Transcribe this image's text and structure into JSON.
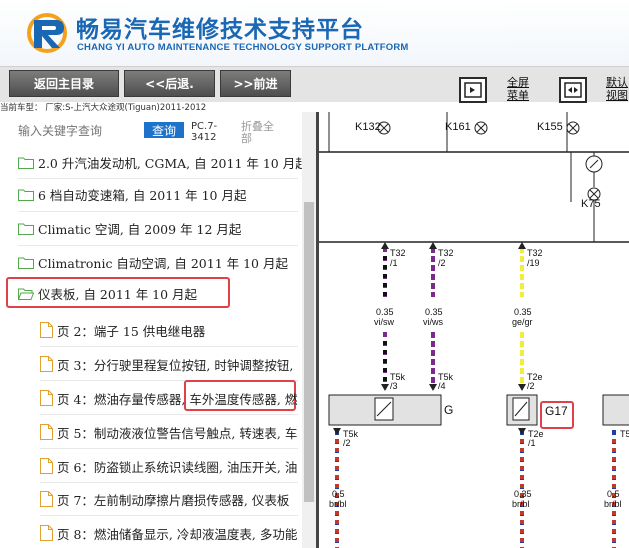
{
  "header": {
    "title": "畅易汽车维修技术支持平台",
    "subtitle": "CHANG YI AUTO MAINTENANCE TECHNOLOGY SUPPORT PLATFORM"
  },
  "toolbar": {
    "back_home": "返回主目录",
    "back": "<<后退.",
    "forward": ">>前进",
    "fullscreen_line1": "全屏",
    "fullscreen_line2": "菜单",
    "default_view_line1": "默认",
    "default_view_line2": "视图"
  },
  "vehicle_info": "当前车型： 厂家:S-上汽大众途观(Tiguan)2011-2012",
  "search": {
    "placeholder": "输入关键字查询",
    "button": "查询",
    "pc_line1": "PC.7-",
    "pc_line2": "3412",
    "collapse_line1": "折叠全",
    "collapse_line2": "部"
  },
  "tree": [
    {
      "label": "2.0 升汽油发动机, CGMA, 自 2011 年 10 月起",
      "type": "folder"
    },
    {
      "label": "6 档自动变速箱, 自 2011 年 10 月起",
      "type": "folder"
    },
    {
      "label": "Climatic 空调, 自 2009 年 12 月起",
      "type": "folder"
    },
    {
      "label": "Climatronic 自动空调, 自 2011 年 10 月起",
      "type": "folder"
    },
    {
      "label": "仪表板, 自 2011 年 10 月起",
      "type": "folder-open"
    },
    {
      "label": "页 2：端子 15 供电继电器",
      "type": "page"
    },
    {
      "label": "页 3：分行驶里程复位按钮, 时钟调整按钮,",
      "type": "page"
    },
    {
      "label": "页 4：燃油存量传感器, 车外温度传感器, 燃",
      "type": "page"
    },
    {
      "label": "页 5：制动液液位警告信号触点, 转速表, 车",
      "type": "page"
    },
    {
      "label": "页 6：防盗锁止系统识读线圈, 油压开关, 油",
      "type": "page"
    },
    {
      "label": "页 7：左前制动摩擦片磨损传感器, 仪表板",
      "type": "page"
    },
    {
      "label": "页 8：燃油储备显示, 冷却液温度表, 多功能",
      "type": "page"
    }
  ],
  "diagram": {
    "components": [
      "K132",
      "K161",
      "K155",
      "K75",
      "G",
      "G17"
    ],
    "wires": [
      {
        "top": "T32",
        "pin_top": "/1",
        "size": "0.35",
        "color": "vi/sw",
        "bottom": "T5k",
        "pin_bottom": "/3"
      },
      {
        "top": "T32",
        "pin_top": "/2",
        "size": "0.35",
        "color": "vi/ws",
        "bottom": "T5k",
        "pin_bottom": "/4"
      },
      {
        "top": "T32",
        "pin_top": "/19",
        "size": "0.35",
        "color": "ge/gr",
        "bottom": "T2e",
        "pin_bottom": "/2"
      }
    ],
    "lower": [
      {
        "conn": "T5k",
        "pin": "/2",
        "size": "0.5",
        "color": "br/bl"
      },
      {
        "conn": "T2e",
        "pin": "/1",
        "size": "0.35",
        "color": "br/bl"
      },
      {
        "conn": "T5",
        "pin": "",
        "size": "0.5",
        "color": "br/bl"
      }
    ]
  },
  "colors": {
    "brand_blue": "#1a67b3",
    "button_dark": "#5a5a5a",
    "highlight_red": "#e0404a",
    "query_blue": "#1c73c9"
  }
}
